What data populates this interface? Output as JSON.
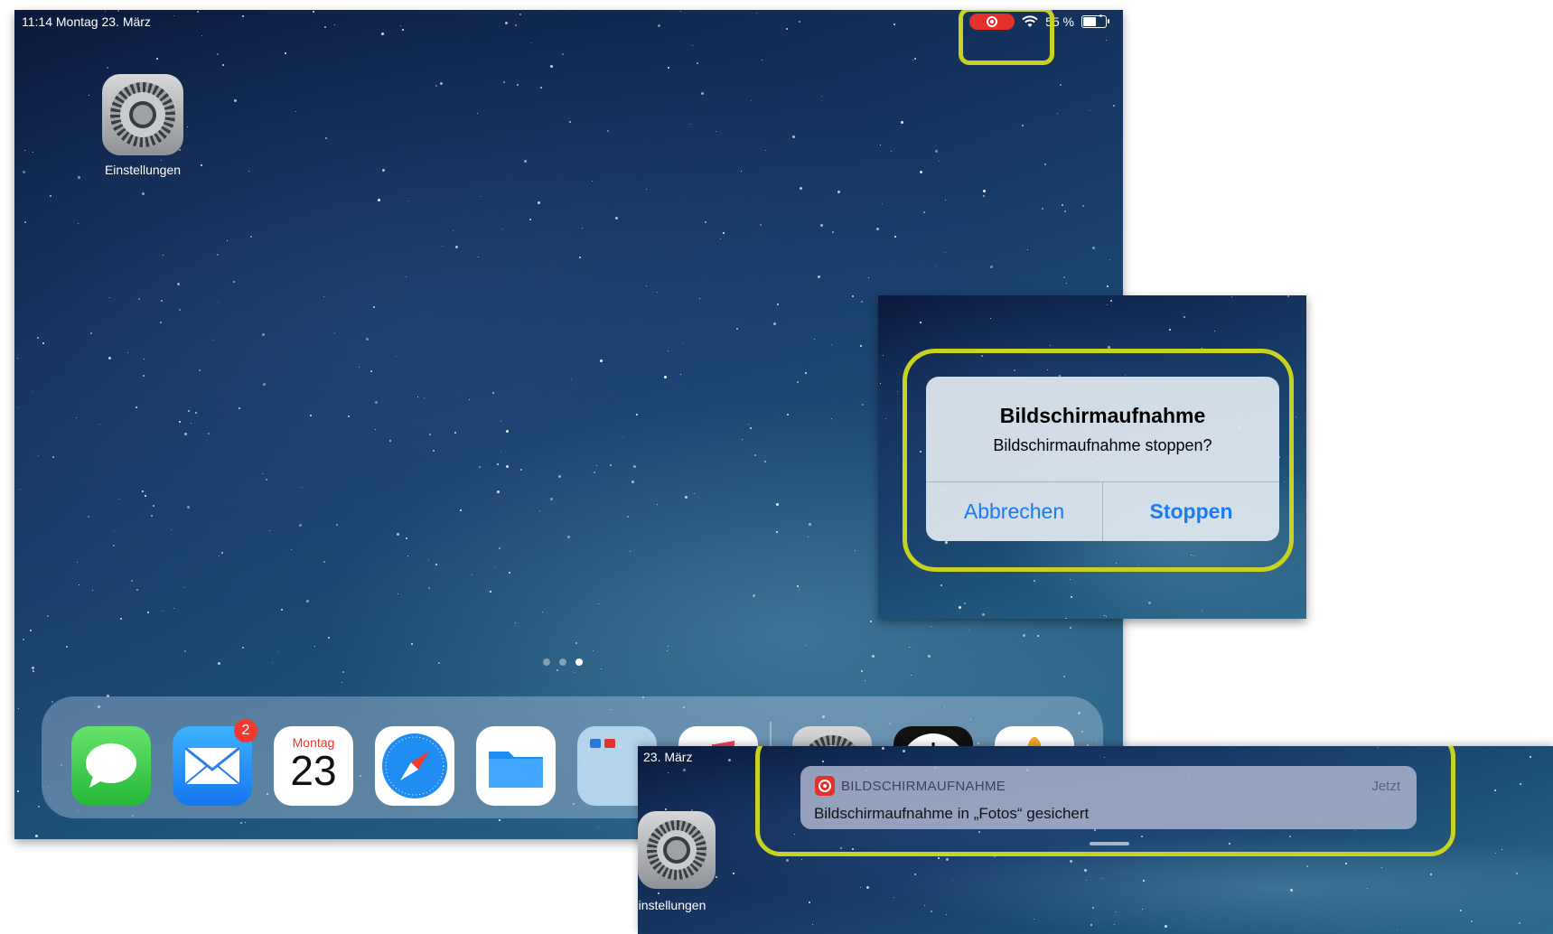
{
  "status_bar": {
    "time_date": "11:14   Montag 23. März",
    "battery": "55 %",
    "recording_indicator": "record-icon",
    "wifi": "wifi-icon"
  },
  "home": {
    "settings_label": "Einstellungen",
    "page_count": 3,
    "active_page": 3
  },
  "dock": {
    "apps": [
      "messages-icon",
      "mail-icon",
      "calendar-icon",
      "safari-icon",
      "files-icon",
      "folder-icon",
      "music-icon",
      "settings-icon",
      "clock-icon",
      "photos-icon"
    ],
    "mail_badge": "2",
    "calendar_weekday": "Montag",
    "calendar_day": "23"
  },
  "dialog": {
    "title": "Bildschirmaufnahme",
    "message": "Bildschirmaufnahme stoppen?",
    "cancel": "Abbrechen",
    "confirm": "Stoppen"
  },
  "notification": {
    "date_fragment": "23. März",
    "app": "BILDSCHIRMAUFNAHME",
    "time": "Jetzt",
    "body": "Bildschirmaufnahme in „Fotos“ gesichert",
    "settings_label_fragment": "instellungen"
  },
  "colors": {
    "highlight": "#c8d321",
    "record_red": "#e6302b",
    "ios_blue": "#1a7cf0"
  }
}
